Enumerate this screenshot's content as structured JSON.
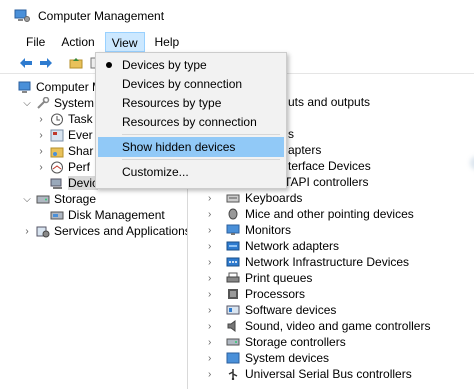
{
  "window": {
    "title": "Computer Management"
  },
  "menubar": {
    "items": [
      "File",
      "Action",
      "View",
      "Help"
    ]
  },
  "view_menu": {
    "items": [
      {
        "label": "Devices by type",
        "checked": true
      },
      {
        "label": "Devices by connection"
      },
      {
        "label": "Resources by type"
      },
      {
        "label": "Resources by connection"
      },
      {
        "label": "Show hidden devices",
        "highlighted": true
      },
      {
        "label": "Customize..."
      }
    ]
  },
  "tree": {
    "items": [
      {
        "label": "Computer M"
      },
      {
        "label": "System T"
      },
      {
        "label": "Task"
      },
      {
        "label": "Ever"
      },
      {
        "label": "Shar"
      },
      {
        "label": "Perf"
      },
      {
        "label": "Devic"
      },
      {
        "label": "Storage"
      },
      {
        "label": "Disk Management"
      },
      {
        "label": "Services and Applications"
      }
    ]
  },
  "devices": {
    "items": [
      "uts and outputs",
      "s",
      "apters",
      "terface Devices",
      "TAPI controllers",
      "Keyboards",
      "Mice and other pointing devices",
      "Monitors",
      "Network adapters",
      "Network Infrastructure Devices",
      "Print queues",
      "Processors",
      "Software devices",
      "Sound, video and game controllers",
      "Storage controllers",
      "System devices",
      "Universal Serial Bus controllers"
    ]
  },
  "colors": {
    "menu_highlight": "#91c9f7",
    "menu_active": "#cce8ff",
    "menu_bg": "#f2f2f2"
  }
}
